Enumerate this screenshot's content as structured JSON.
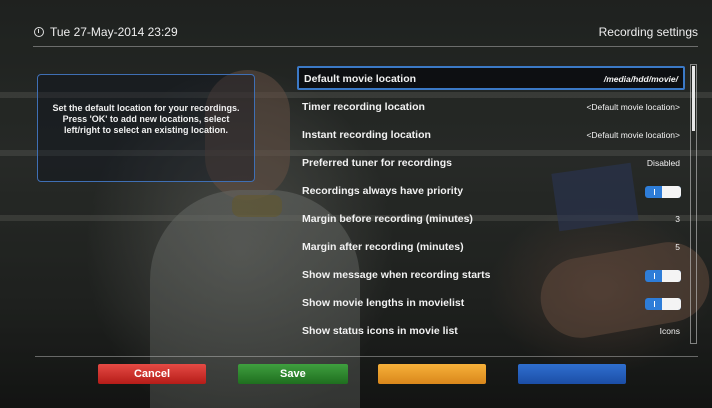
{
  "header": {
    "datetime": "Tue 27-May-2014 23:29",
    "title": "Recording settings",
    "clock_icon": "clock-icon"
  },
  "help_text": "Set the default location for your recordings. Press 'OK' to add new locations, select left/right to select an existing location.",
  "settings": [
    {
      "label": "Default movie location",
      "value": "/media/hdd/movie/",
      "type": "text",
      "selected": true
    },
    {
      "label": "Timer recording location",
      "value": "<Default movie location>",
      "type": "text"
    },
    {
      "label": "Instant recording location",
      "value": "<Default movie location>",
      "type": "text"
    },
    {
      "label": "Preferred tuner for recordings",
      "value": "Disabled",
      "type": "text"
    },
    {
      "label": "Recordings always have priority",
      "value": "on",
      "type": "toggle"
    },
    {
      "label": "Margin before recording (minutes)",
      "value": "3",
      "type": "text"
    },
    {
      "label": "Margin after recording (minutes)",
      "value": "5",
      "type": "text"
    },
    {
      "label": "Show message when recording starts",
      "value": "on",
      "type": "toggle"
    },
    {
      "label": "Show movie lengths in movielist",
      "value": "on",
      "type": "toggle"
    },
    {
      "label": "Show status icons in movie list",
      "value": "Icons",
      "type": "text"
    }
  ],
  "scrollbar": {
    "position": 0.0
  },
  "buttons": {
    "red": "Cancel",
    "green": "Save",
    "yellow": "",
    "blue": ""
  },
  "colors": {
    "accent": "#3b79c6",
    "red": "#d0302b",
    "green": "#2f8a2f",
    "yellow": "#f0a42d",
    "blue": "#2a62c2"
  }
}
